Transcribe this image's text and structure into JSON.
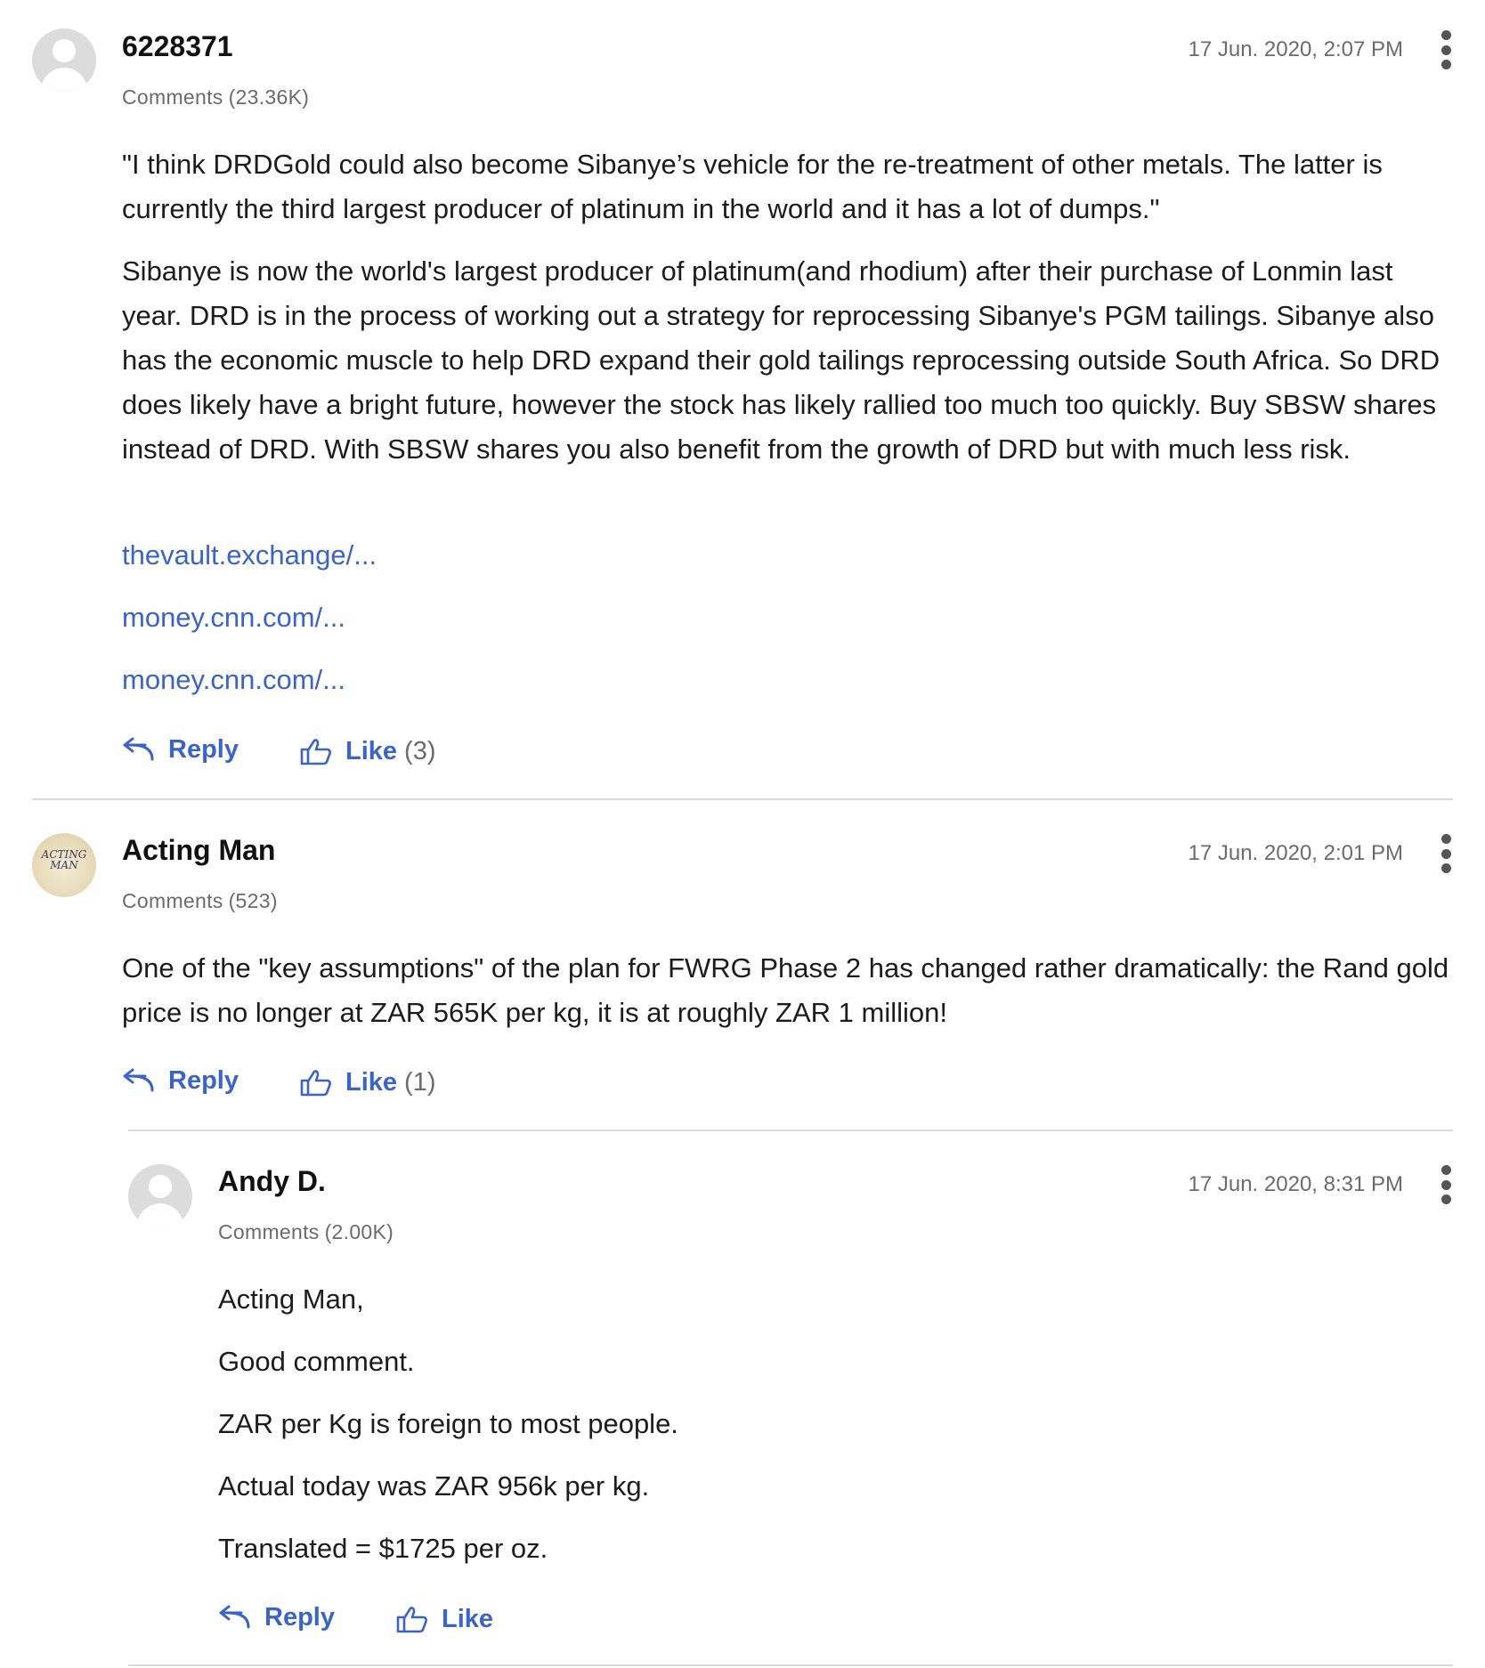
{
  "colors": {
    "link": "#3a64c8",
    "muted": "#6b6b6b",
    "text": "#1c1c1c",
    "divider": "#dcdcdc"
  },
  "comments": [
    {
      "author": "6228371",
      "comments_label": "Comments",
      "comments_count": "(23.36K)",
      "timestamp": "17 Jun. 2020, 2:07 PM",
      "avatar": "default-avatar-icon",
      "paragraphs": [
        "\"I think DRDGold could also become Sibanye’s vehicle for the re-treatment of other metals. The latter is currently the third largest producer of platinum in the world and it has a lot of dumps.\"",
        "Sibanye is now the world's largest producer of platinum(and rhodium) after their purchase of Lonmin last year. DRD is in the process of working out a strategy for reprocessing Sibanye's PGM tailings. Sibanye also has the economic muscle to help DRD expand their gold tailings reprocessing outside South Africa. So DRD does likely have a bright future, however the stock has likely rallied too much too quickly. Buy SBSW shares instead of DRD. With SBSW shares you also benefit from the growth of DRD but with much less risk."
      ],
      "links": [
        "thevault.exchange/...",
        "money.cnn.com/...",
        "money.cnn.com/..."
      ],
      "reply_label": "Reply",
      "like_label": "Like",
      "like_count": "(3)"
    },
    {
      "author": "Acting Man",
      "comments_label": "Comments",
      "comments_count": "(523)",
      "timestamp": "17 Jun. 2020, 2:01 PM",
      "avatar": "acting-man-logo-icon",
      "avatar_text": [
        "ACTING",
        "MAN"
      ],
      "paragraphs": [
        "One of the \"key assumptions\" of the plan for FWRG Phase 2 has changed rather dramatically: the Rand gold price is no longer at ZAR 565K per kg, it is at roughly ZAR 1 million!"
      ],
      "reply_label": "Reply",
      "like_label": "Like",
      "like_count": "(1)"
    },
    {
      "author": "Andy D.",
      "comments_label": "Comments",
      "comments_count": "(2.00K)",
      "timestamp": "17 Jun. 2020, 8:31 PM",
      "avatar": "default-avatar-icon",
      "paragraphs": [
        "Acting Man,",
        "Good comment.",
        "ZAR per Kg is foreign to most people.",
        "Actual today was ZAR 956k per kg.",
        "Translated = $1725 per oz."
      ],
      "reply_label": "Reply",
      "like_label": "Like"
    }
  ]
}
